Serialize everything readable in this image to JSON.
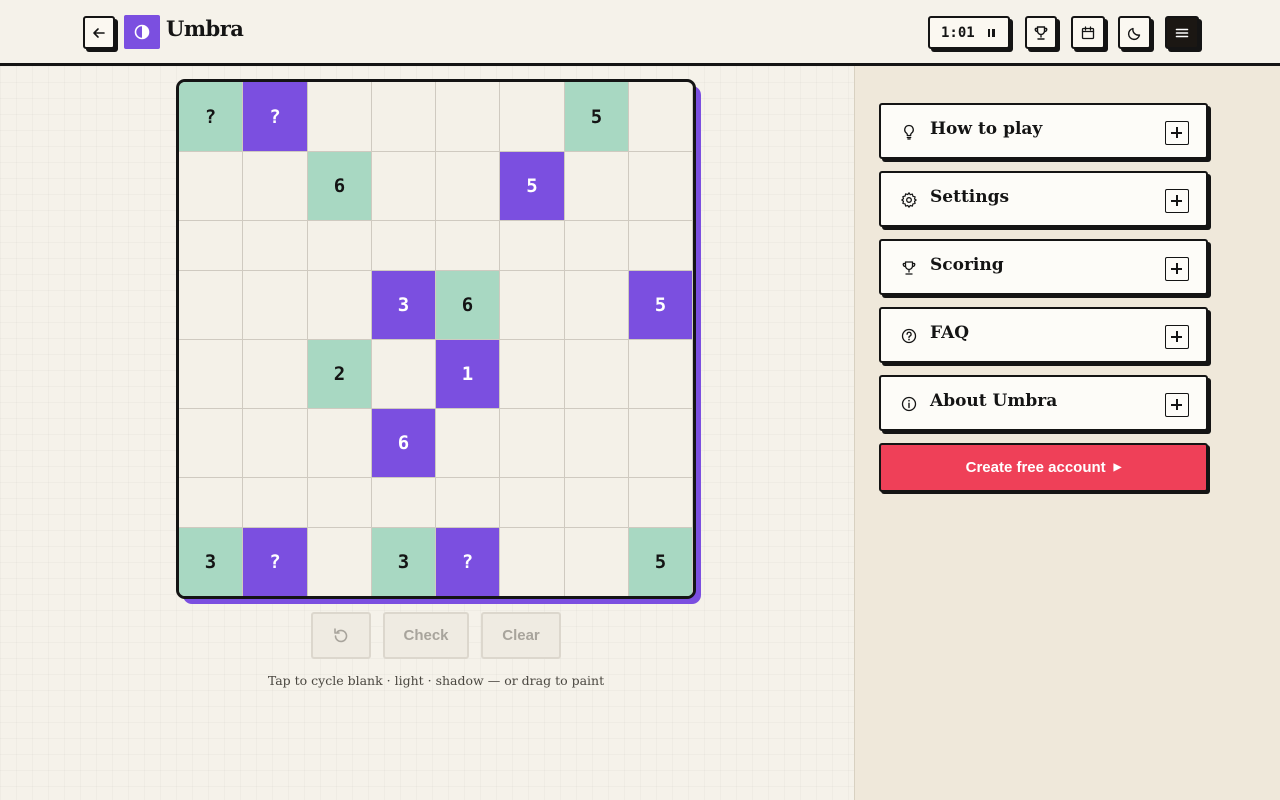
{
  "app": {
    "name": "Umbra"
  },
  "header": {
    "timer": "1:01"
  },
  "board": {
    "size": 8,
    "cells": [
      {
        "r": 0,
        "c": 0,
        "state": "light",
        "label": "?"
      },
      {
        "r": 0,
        "c": 1,
        "state": "shadow",
        "label": "?"
      },
      {
        "r": 0,
        "c": 6,
        "state": "light",
        "label": "5"
      },
      {
        "r": 1,
        "c": 2,
        "state": "light",
        "label": "6"
      },
      {
        "r": 1,
        "c": 5,
        "state": "shadow",
        "label": "5"
      },
      {
        "r": 3,
        "c": 3,
        "state": "shadow",
        "label": "3"
      },
      {
        "r": 3,
        "c": 4,
        "state": "light",
        "label": "6"
      },
      {
        "r": 3,
        "c": 7,
        "state": "shadow",
        "label": "5"
      },
      {
        "r": 4,
        "c": 2,
        "state": "light",
        "label": "2"
      },
      {
        "r": 4,
        "c": 4,
        "state": "shadow",
        "label": "1"
      },
      {
        "r": 5,
        "c": 3,
        "state": "shadow",
        "label": "6"
      },
      {
        "r": 7,
        "c": 0,
        "state": "light",
        "label": "3"
      },
      {
        "r": 7,
        "c": 1,
        "state": "shadow",
        "label": "?"
      },
      {
        "r": 7,
        "c": 3,
        "state": "light",
        "label": "3"
      },
      {
        "r": 7,
        "c": 4,
        "state": "shadow",
        "label": "?"
      },
      {
        "r": 7,
        "c": 7,
        "state": "light",
        "label": "5"
      }
    ]
  },
  "controls": {
    "check_label": "Check",
    "clear_label": "Clear"
  },
  "hint": "Tap to cycle blank · light · shadow — or drag to paint",
  "sidebar": {
    "sections": [
      {
        "label": "How to play",
        "icon": "lightbulb-icon"
      },
      {
        "label": "Settings",
        "icon": "gear-icon"
      },
      {
        "label": "Scoring",
        "icon": "trophy-icon"
      },
      {
        "label": "FAQ",
        "icon": "question-circle-icon"
      },
      {
        "label": "About Umbra",
        "icon": "info-circle-icon"
      }
    ],
    "cta_label": "Create free account"
  },
  "colors": {
    "shadow": "#7b4fe0",
    "light": "#a8d8c2",
    "cta": "#ef4058",
    "ink": "#141414"
  }
}
